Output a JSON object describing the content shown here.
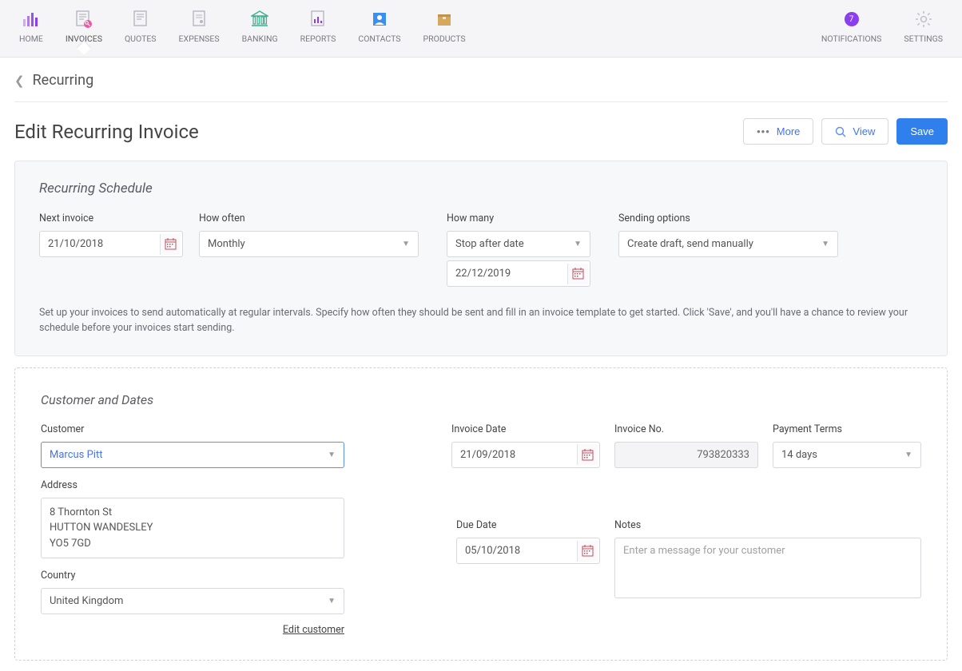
{
  "nav": {
    "items": [
      {
        "label": "HOME"
      },
      {
        "label": "INVOICES"
      },
      {
        "label": "QUOTES"
      },
      {
        "label": "EXPENSES"
      },
      {
        "label": "BANKING"
      },
      {
        "label": "REPORTS"
      },
      {
        "label": "CONTACTS"
      },
      {
        "label": "PRODUCTS"
      }
    ],
    "notifications_label": "NOTIFICATIONS",
    "notifications_count": "7",
    "settings_label": "SETTINGS"
  },
  "breadcrumb": {
    "label": "Recurring"
  },
  "title": "Edit Recurring Invoice",
  "actions": {
    "more": "More",
    "view": "View",
    "save": "Save"
  },
  "schedule": {
    "heading": "Recurring Schedule",
    "next_invoice_label": "Next invoice",
    "next_invoice": "21/10/2018",
    "how_often_label": "How often",
    "how_often": "Monthly",
    "how_many_label": "How many",
    "how_many": "Stop after date",
    "stop_date": "22/12/2019",
    "sending_label": "Sending options",
    "sending": "Create draft, send manually",
    "help": "Set up your invoices to send automatically at regular intervals. Specify how often they should be sent and fill in an invoice template to get started. Click 'Save', and you'll have a chance to review your schedule before your invoices start sending."
  },
  "customer": {
    "heading": "Customer and Dates",
    "customer_label": "Customer",
    "customer_value": "Marcus Pitt",
    "address_label": "Address",
    "address_line1": "8 Thornton St",
    "address_line2": "HUTTON WANDESLEY",
    "address_line3": "YO5 7GD",
    "country_label": "Country",
    "country": "United Kingdom",
    "edit_link": "Edit customer"
  },
  "invoice": {
    "date_label": "Invoice Date",
    "date": "21/09/2018",
    "number_label": "Invoice No.",
    "number": "793820333",
    "terms_label": "Payment Terms",
    "terms": "14 days",
    "due_label": "Due Date",
    "due": "05/10/2018",
    "notes_label": "Notes",
    "notes_placeholder": "Enter a message for your customer"
  }
}
